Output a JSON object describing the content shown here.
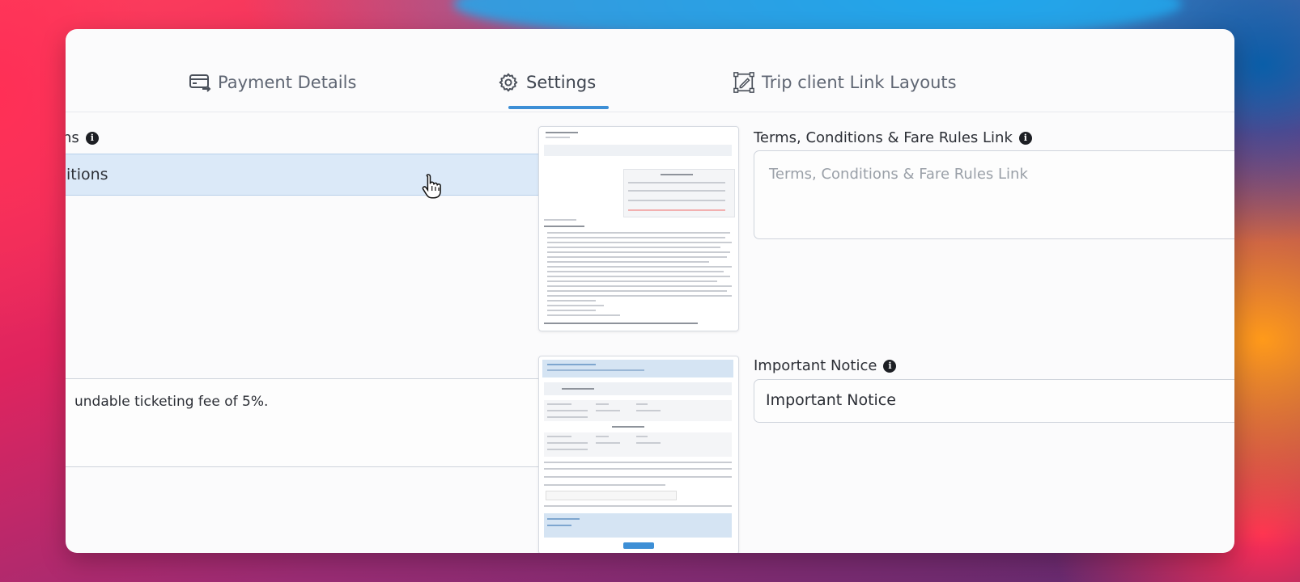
{
  "tabs": [
    {
      "label": "Payment Details",
      "icon": "card-transfer-icon",
      "active": false
    },
    {
      "label": "Settings",
      "icon": "gear-icon",
      "active": true
    },
    {
      "label": "Trip client Link Layouts",
      "icon": "layout-edit-icon",
      "active": false
    }
  ],
  "left": {
    "select_label": "ns",
    "select_value": "itions",
    "textarea_value": "undable ticketing fee of 5%."
  },
  "right": {
    "terms_label": "Terms, Conditions & Fare Rules Link",
    "terms_placeholder": "Terms, Conditions & Fare Rules Link",
    "notice_label": "Important Notice",
    "notice_value": "Important Notice"
  },
  "colors": {
    "accent": "#3d8fd6",
    "select_bg": "#dbe9f8"
  }
}
